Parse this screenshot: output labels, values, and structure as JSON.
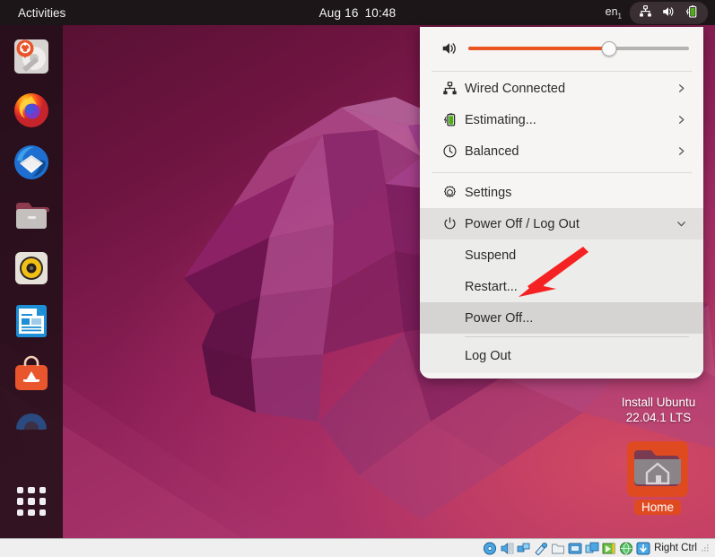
{
  "topbar": {
    "activities": "Activities",
    "date": "Aug 16",
    "time": "10:48",
    "keyboard_layout": "en",
    "keyboard_sub": "1",
    "indicator_icons": [
      "wired-network-icon",
      "volume-icon",
      "battery-charging-icon"
    ]
  },
  "dock": {
    "items": [
      {
        "name": "ubuntu-installer",
        "icon": "disk-installer-icon"
      },
      {
        "name": "firefox",
        "icon": "firefox-icon"
      },
      {
        "name": "thunderbird",
        "icon": "thunderbird-mail-icon"
      },
      {
        "name": "files",
        "icon": "files-folder-icon"
      },
      {
        "name": "rhythmbox",
        "icon": "rhythmbox-speaker-icon"
      },
      {
        "name": "libreoffice-writer",
        "icon": "libreoffice-writer-icon"
      },
      {
        "name": "ubuntu-software",
        "icon": "ubuntu-software-bag-icon"
      },
      {
        "name": "help",
        "icon": "help-lifebuoy-icon"
      }
    ],
    "show_apps_label": "Show Applications"
  },
  "desktop": {
    "install_icon_line1": "Install Ubuntu",
    "install_icon_line2": "22.04.1 LTS",
    "home_icon_label": "Home"
  },
  "system_menu": {
    "volume": {
      "icon": "volume-icon",
      "value": 64,
      "accent": "#e95420"
    },
    "items": [
      {
        "id": "wired",
        "icon": "wired-network-icon",
        "label": "Wired Connected",
        "chevron": "right"
      },
      {
        "id": "battery",
        "icon": "battery-charging-icon",
        "label": "Estimating...",
        "chevron": "right"
      },
      {
        "id": "power-profile",
        "icon": "power-profile-icon",
        "label": "Balanced",
        "chevron": "right"
      }
    ],
    "settings": {
      "id": "settings",
      "icon": "gear-icon",
      "label": "Settings"
    },
    "power": {
      "id": "power",
      "icon": "power-icon",
      "label": "Power Off / Log Out",
      "chevron": "down",
      "expanded": true
    },
    "submenu": [
      {
        "id": "suspend",
        "label": "Suspend",
        "highlighted": false
      },
      {
        "id": "restart",
        "label": "Restart...",
        "highlighted": false
      },
      {
        "id": "power-off",
        "label": "Power Off...",
        "highlighted": true
      }
    ],
    "submenu_footer": {
      "id": "log-out",
      "label": "Log Out"
    }
  },
  "annotation": {
    "arrow": "red-arrow-pointing-to-restart",
    "color": "#f42222"
  },
  "vbox_status": {
    "icons": [
      "optical-disk-icon",
      "audio-icon",
      "network-icon",
      "usb-icon",
      "shared-folders-icon",
      "display-icon",
      "recording-icon",
      "mouse-integration-icon",
      "globe-icon",
      "host-key-icon"
    ],
    "host_key": "Right Ctrl"
  }
}
